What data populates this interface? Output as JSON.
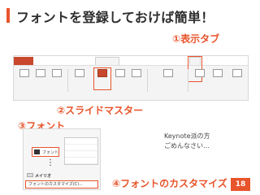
{
  "title": "フォントを登録しておけば簡単！",
  "callouts": {
    "view_tab": "①表示タブ",
    "slide_master": "②スライドマスター",
    "font": "③フォント",
    "customize": "④フォントのカスタマイズ"
  },
  "note": {
    "line1": "Keynote派の方",
    "line2": "ごめんなさい…"
  },
  "page_number": "18",
  "colors": {
    "accent": "#e8542b"
  },
  "dropdown": {
    "font_button": "フォント",
    "meiryo": "メイリオ",
    "customize_item": "フォントのカスタマイズ(C)..."
  }
}
